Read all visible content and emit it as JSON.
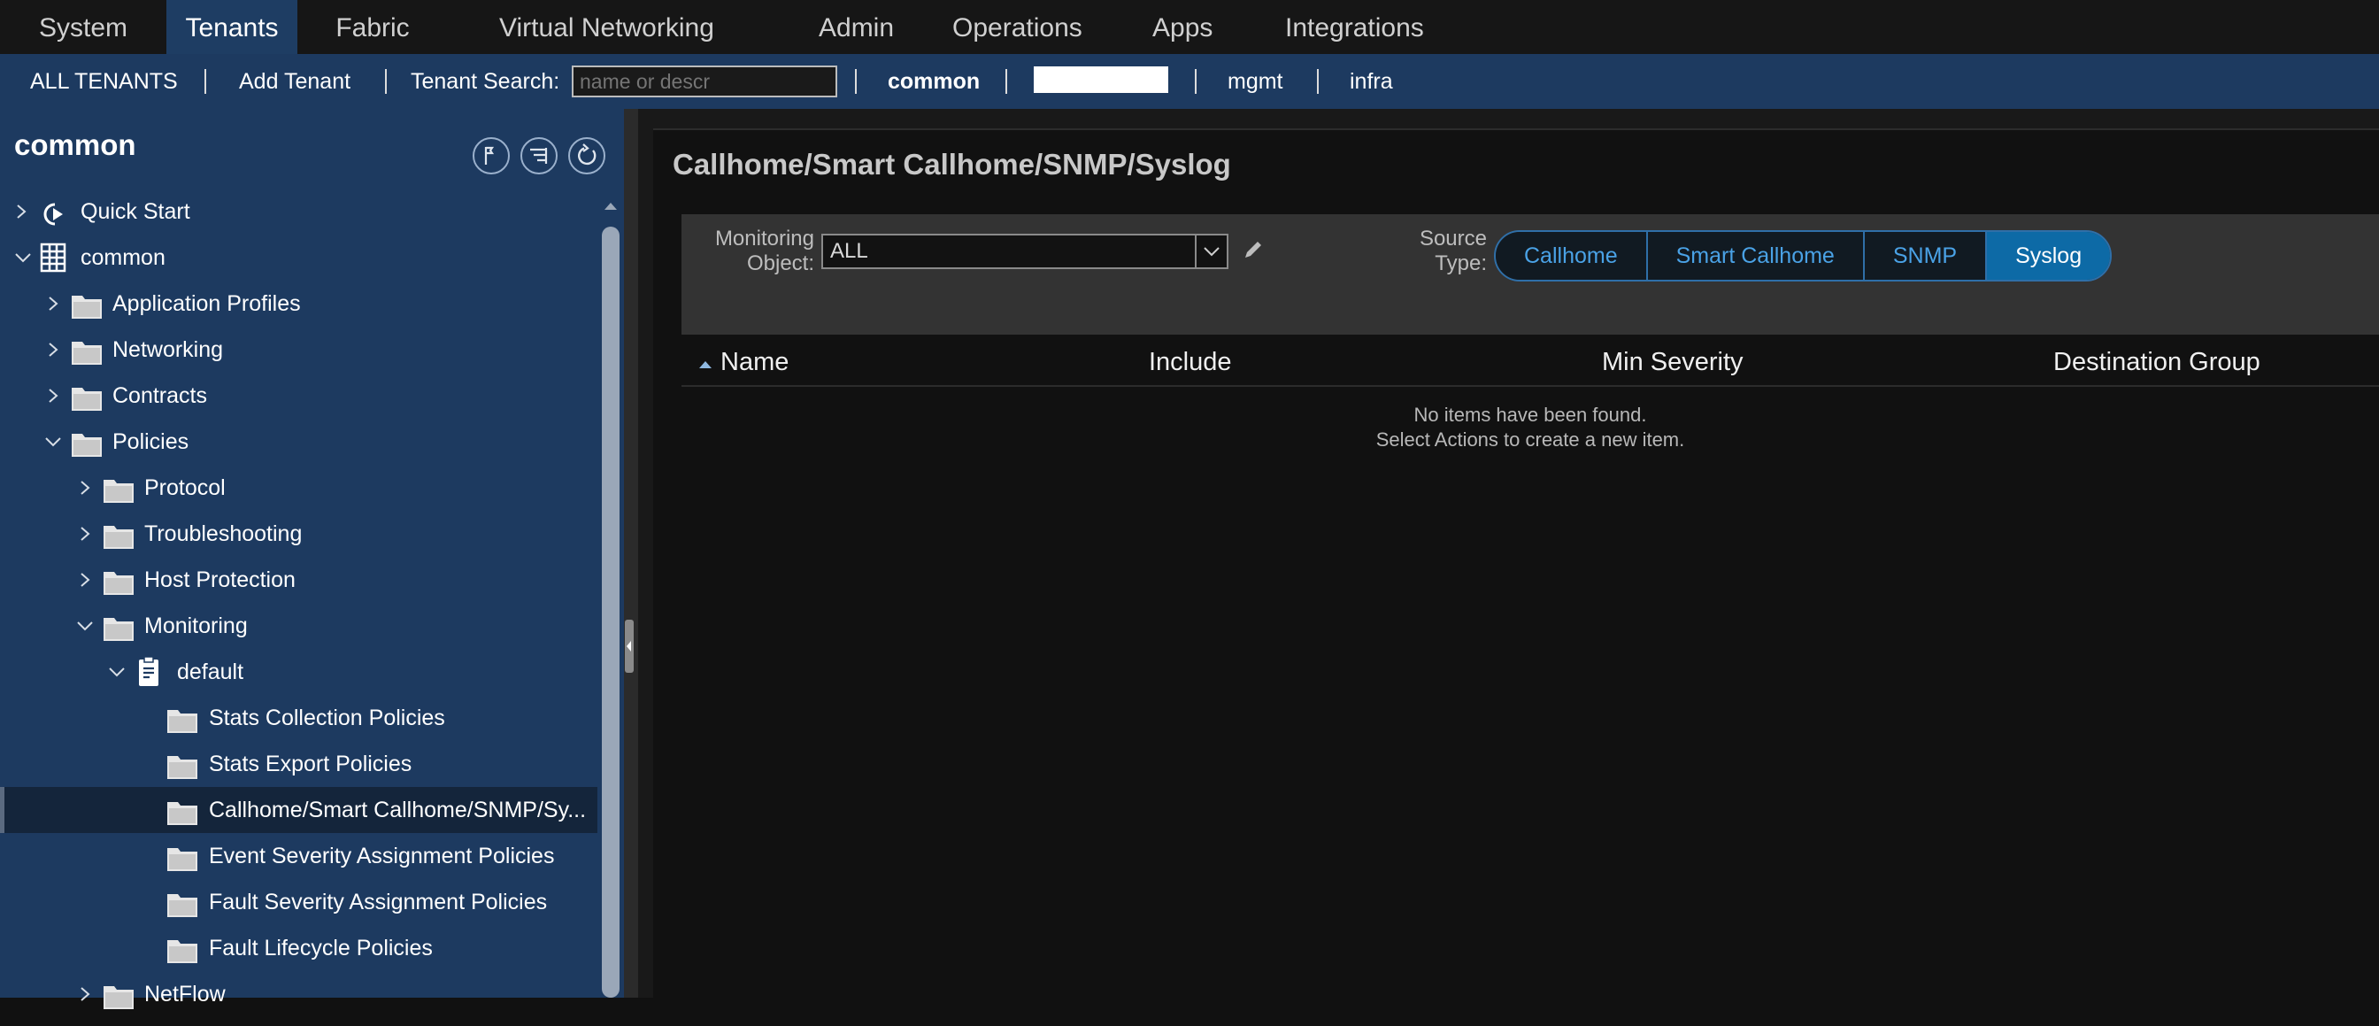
{
  "topnav": {
    "tabs": [
      {
        "label": "System"
      },
      {
        "label": "Tenants",
        "active": true
      },
      {
        "label": "Fabric"
      },
      {
        "label": "Virtual Networking"
      },
      {
        "label": "Admin"
      },
      {
        "label": "Operations"
      },
      {
        "label": "Apps"
      },
      {
        "label": "Integrations"
      }
    ]
  },
  "subnav": {
    "all_tenants": "ALL TENANTS",
    "add_tenant": "Add Tenant",
    "search_label": "Tenant Search:",
    "search_placeholder": "name or descr",
    "tenants": [
      "common",
      "mgmt",
      "infra"
    ]
  },
  "sidebar": {
    "title": "common",
    "tree": [
      {
        "label": "Quick Start",
        "icon": "quick-start-icon",
        "expanded": false
      },
      {
        "label": "common",
        "icon": "tenant-grid-icon",
        "expanded": true
      },
      {
        "label": "Application Profiles",
        "icon": "folder-icon",
        "expanded": false
      },
      {
        "label": "Networking",
        "icon": "folder-icon",
        "expanded": false
      },
      {
        "label": "Contracts",
        "icon": "folder-icon",
        "expanded": false
      },
      {
        "label": "Policies",
        "icon": "folder-icon",
        "expanded": true
      },
      {
        "label": "Protocol",
        "icon": "folder-icon",
        "expanded": false
      },
      {
        "label": "Troubleshooting",
        "icon": "folder-icon",
        "expanded": false
      },
      {
        "label": "Host Protection",
        "icon": "folder-icon",
        "expanded": false
      },
      {
        "label": "Monitoring",
        "icon": "folder-icon",
        "expanded": true
      },
      {
        "label": "default",
        "icon": "document-icon",
        "expanded": true
      },
      {
        "label": "Stats Collection Policies",
        "icon": "folder-icon"
      },
      {
        "label": "Stats Export Policies",
        "icon": "folder-icon"
      },
      {
        "label": "Callhome/Smart Callhome/SNMP/Sy...",
        "icon": "folder-icon",
        "selected": true
      },
      {
        "label": "Event Severity Assignment Policies",
        "icon": "folder-icon"
      },
      {
        "label": "Fault Severity Assignment Policies",
        "icon": "folder-icon"
      },
      {
        "label": "Fault Lifecycle Policies",
        "icon": "folder-icon"
      },
      {
        "label": "NetFlow",
        "icon": "folder-icon",
        "expanded": false
      }
    ]
  },
  "main": {
    "title": "Callhome/Smart Callhome/SNMP/Syslog",
    "monitoring_object_label": "Monitoring Object:",
    "monitoring_object_value": "ALL",
    "source_type_label": "Source Type:",
    "source_types": [
      {
        "label": "Callhome"
      },
      {
        "label": "Smart Callhome"
      },
      {
        "label": "SNMP"
      },
      {
        "label": "Syslog",
        "active": true
      }
    ],
    "columns": [
      "Name",
      "Include",
      "Min Severity",
      "Destination Group"
    ],
    "empty_line1": "No items have been found.",
    "empty_line2": "Select Actions to create a new item."
  },
  "colors": {
    "nav_active": "#1e3d63",
    "subnav_bg": "#1d3a60",
    "segment_active": "#0d6aa6",
    "segment_text": "#4aa2e6"
  }
}
